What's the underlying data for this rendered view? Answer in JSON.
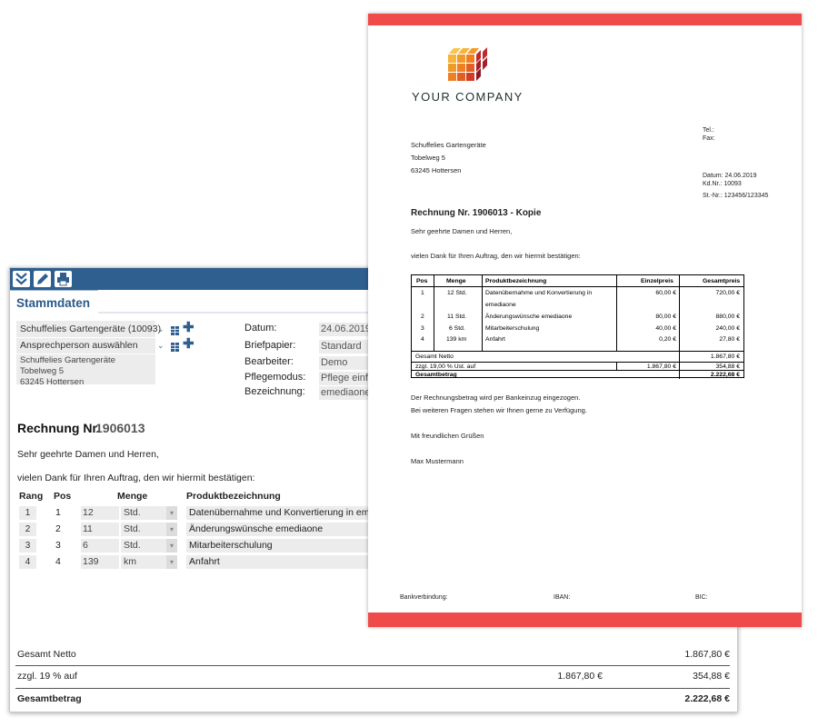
{
  "app": {
    "toolbar": {
      "icons": [
        "expand-down-icon",
        "pencil-icon",
        "printer-icon"
      ]
    },
    "tab_label": "Stammdaten",
    "customer": {
      "select_value": "Schuffelies Gartengeräte (10093)",
      "contact_placeholder": "Ansprechperson auswählen",
      "address": [
        "Schuffelies Gartengeräte",
        "Tobelweg 5",
        "63245 Hottersen"
      ]
    },
    "fields": [
      {
        "label": "Datum:",
        "value": "24.06.2019"
      },
      {
        "label": "Briefpapier:",
        "value": "Standard"
      },
      {
        "label": "Bearbeiter:",
        "value": "Demo"
      },
      {
        "label": "Pflegemodus:",
        "value": "Pflege einfach"
      },
      {
        "label": "Bezeichnung:",
        "value": "emediaone D"
      }
    ],
    "invoice_label": "Rechnung Nr.",
    "invoice_number": "1906013",
    "greeting": "Sehr geehrte Damen und Herren,",
    "intro": "vielen Dank für Ihren Auftrag, den wir hiermit bestätigen:",
    "table_headers": {
      "rank": "Rang",
      "pos": "Pos",
      "qty": "Menge",
      "product": "Produktbezeichnung"
    },
    "rows": [
      {
        "rank": "1",
        "pos": "1",
        "qty": "12",
        "unit": "Std.",
        "product": "Datenübernahme und Konvertierung in emediaone"
      },
      {
        "rank": "2",
        "pos": "2",
        "qty": "11",
        "unit": "Std.",
        "product": "Änderungswünsche emediaone"
      },
      {
        "rank": "3",
        "pos": "3",
        "qty": "6",
        "unit": "Std.",
        "product": "Mitarbeiterschulung"
      },
      {
        "rank": "4",
        "pos": "4",
        "qty": "139",
        "unit": "km",
        "product": "Anfahrt"
      }
    ],
    "totals": {
      "netto_label": "Gesamt Netto",
      "netto": "1.867,80 €",
      "tax_label": "zzgl. 19 % auf",
      "tax_base": "1.867,80 €",
      "tax": "354,88 €",
      "gross_label": "Gesamtbetrag",
      "gross": "2.222,68 €"
    }
  },
  "document": {
    "company": "YOUR COMPANY",
    "recipient": [
      "Schuffelies Gartengeräte",
      "Tobelweg 5",
      "63245 Hottersen"
    ],
    "tel_label": "Tel.:",
    "fax_label": "Fax:",
    "date_line": "Datum: 24.06.2019",
    "customer_no_line": "Kd.Nr.: 10093",
    "tax_no_line": "St.-Nr.: 123456/123345",
    "title": "Rechnung Nr. 1906013 - Kopie",
    "greeting": "Sehr geehrte Damen und Herren,",
    "intro": "vielen Dank für Ihren Auftrag, den wir hiermit bestätigen:",
    "table_headers": [
      "Pos",
      "Menge",
      "Produktbezeichnung",
      "Einzelpreis",
      "Gesamtpreis"
    ],
    "rows": [
      {
        "pos": "1",
        "qty": "12 Std.",
        "product": "Datenübernahme und Konvertierung in",
        "product2": "emediaone",
        "unit_price": "60,00 €",
        "total": "720,00 €"
      },
      {
        "pos": "2",
        "qty": "11 Std.",
        "product": "Änderungswünsche emediaone",
        "unit_price": "80,00 €",
        "total": "880,00 €"
      },
      {
        "pos": "3",
        "qty": "6 Std.",
        "product": "Mitarbeiterschulung",
        "unit_price": "40,00 €",
        "total": "240,00 €"
      },
      {
        "pos": "4",
        "qty": "139 km",
        "product": "Anfahrt",
        "unit_price": "0,20 €",
        "total": "27,80 €"
      }
    ],
    "netto_label": "Gesamt Netto",
    "netto": "1.867,80 €",
    "tax_label": "zzgl. 19,00 % Ust. auf",
    "tax_base": "1.867,80 €",
    "tax": "354,88 €",
    "gross_label": "Gesamtbetrag",
    "gross": "2.222,68 €",
    "closing1": "Der Rechnungsbetrag wird per Bankeinzug eingezogen.",
    "closing2": "Bei weiteren Fragen stehen wir Ihnen gerne zu Verfügung.",
    "regards": "Mit freundlichen Grüßen",
    "signature": "Max Mustermann",
    "footer": {
      "bank": "Bankverbindung:",
      "iban": "IBAN:",
      "bic": "BIC:"
    }
  },
  "colors": {
    "toolbar": "#2f5f8f",
    "accent_red": "#ef4b4b",
    "logo_orange": "#f0a020",
    "logo_red": "#c0282a"
  }
}
